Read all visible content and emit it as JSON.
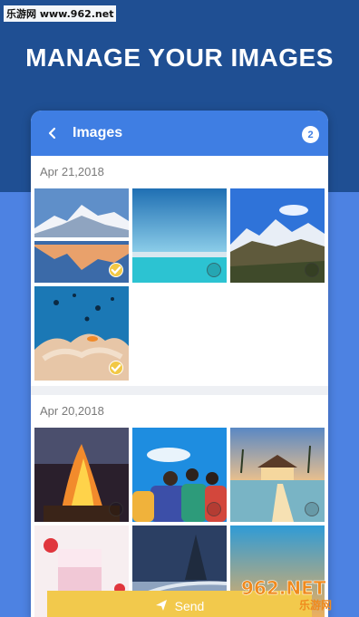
{
  "watermark_top": "乐游网 www.962.net",
  "headline": "MANAGE YOUR IMAGES",
  "appbar": {
    "title": "Images",
    "selected_count": "2",
    "back_icon": "chevron-left-icon"
  },
  "sections": [
    {
      "date": "Apr 21,2018",
      "photos": [
        {
          "subject": "snowy mountain lake reflection",
          "selected": true
        },
        {
          "subject": "turquoise lake and sky",
          "selected": false
        },
        {
          "subject": "mountain valley landscape",
          "selected": false
        },
        {
          "subject": "coral reef with fish",
          "selected": true
        }
      ]
    },
    {
      "date": "Apr 20,2018",
      "photos": [
        {
          "subject": "bonfire at night",
          "selected": false
        },
        {
          "subject": "friends hugging under blue sky",
          "selected": false
        },
        {
          "subject": "tropical resort pier at dusk",
          "selected": false
        },
        {
          "subject": "strawberry milkshake",
          "selected": false
        },
        {
          "subject": "road in winter landscape",
          "selected": false
        },
        {
          "subject": "beach sky gradient",
          "selected": false
        }
      ]
    }
  ],
  "send": {
    "label": "Send",
    "icon": "paper-plane-icon"
  },
  "watermark_logo": {
    "big": "962.NET",
    "small": "乐游网"
  },
  "colors": {
    "top_bg": "#1f4f93",
    "bottom_bg": "#4d82e2",
    "appbar": "#3f7ee3",
    "accent": "#f2c94c"
  }
}
